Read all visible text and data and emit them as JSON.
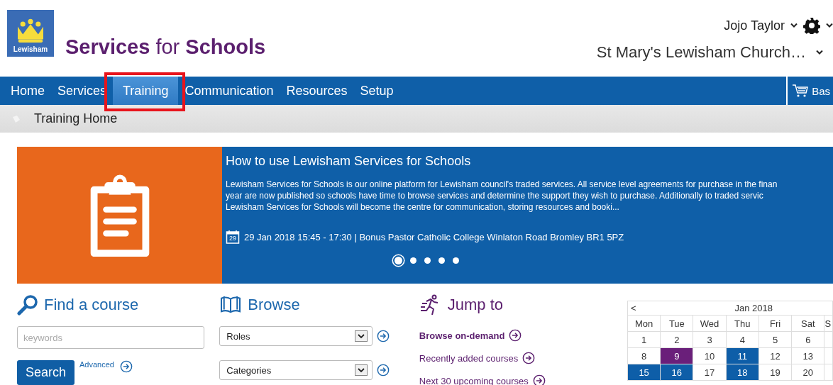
{
  "logo": {
    "label": "Lewisham"
  },
  "site_title": "**Services** for **Schools**",
  "user": {
    "name": "Jojo Taylor"
  },
  "school": {
    "name": "St Mary's Lewisham Church…"
  },
  "nav": {
    "tabs": [
      {
        "label": "Home",
        "selected": false,
        "highlighted": false
      },
      {
        "label": "Services",
        "selected": false,
        "highlighted": false
      },
      {
        "label": "Training",
        "selected": true,
        "highlighted": true
      },
      {
        "label": "Communication",
        "selected": false,
        "highlighted": false
      },
      {
        "label": "Resources",
        "selected": false,
        "highlighted": false
      },
      {
        "label": "Setup",
        "selected": false,
        "highlighted": false
      }
    ],
    "basket": "Bas"
  },
  "breadcrumb": "Training Home",
  "banner": {
    "title": "How to use Lewisham Services for Schools",
    "body_lines": [
      "Lewisham Services for Schools is our online platform for Lewisham council's traded services. All service level agreements for purchase in the finan",
      "year are now published so schools have time to browse services and determine the support they wish to purchase. Additionally to traded servic",
      "Lewisham Services for Schools will become the centre for communication, storing resources and booki..."
    ],
    "date_icon": "29",
    "event": "29 Jan 2018 15:45 - 17:30 | Bonus Pastor Catholic College Winlaton Road Bromley BR1 5PZ",
    "dots": [
      {
        "selected": true
      },
      {
        "selected": false
      },
      {
        "selected": false
      },
      {
        "selected": false
      },
      {
        "selected": false
      }
    ]
  },
  "find": {
    "heading": "Find a course",
    "placeholder": "keywords",
    "button": "Search",
    "advanced": "Advanced"
  },
  "browse": {
    "heading": "Browse",
    "selects": [
      "Roles",
      "Categories"
    ]
  },
  "jump": {
    "heading": "Jump to",
    "links": [
      {
        "label": "Browse on-demand",
        "bold": true
      },
      {
        "label": "Recently added courses",
        "bold": false
      },
      {
        "label": "Next 30 upcoming courses",
        "bold": false
      }
    ]
  },
  "calendar": {
    "prev": "<",
    "month": "Jan 2018",
    "days": [
      "Mon",
      "Tue",
      "Wed",
      "Thu",
      "Fri",
      "Sat",
      "S"
    ],
    "weeks": [
      [
        {
          "day": "1"
        },
        {
          "day": "2"
        },
        {
          "day": "3"
        },
        {
          "day": "4"
        },
        {
          "day": "5"
        },
        {
          "day": "6"
        }
      ],
      [
        {
          "day": "8"
        },
        {
          "day": "9",
          "color": "#6a1f7a"
        },
        {
          "day": "10"
        },
        {
          "day": "11",
          "color": "#0e5ea8"
        },
        {
          "day": "12"
        },
        {
          "day": "13"
        }
      ],
      [
        {
          "day": "15",
          "color": "#0e5ea8"
        },
        {
          "day": "16",
          "color": "#0e5ea8"
        },
        {
          "day": "17"
        },
        {
          "day": "18",
          "color": "#0e5ea8"
        },
        {
          "day": "19"
        },
        {
          "day": "20"
        }
      ]
    ]
  }
}
